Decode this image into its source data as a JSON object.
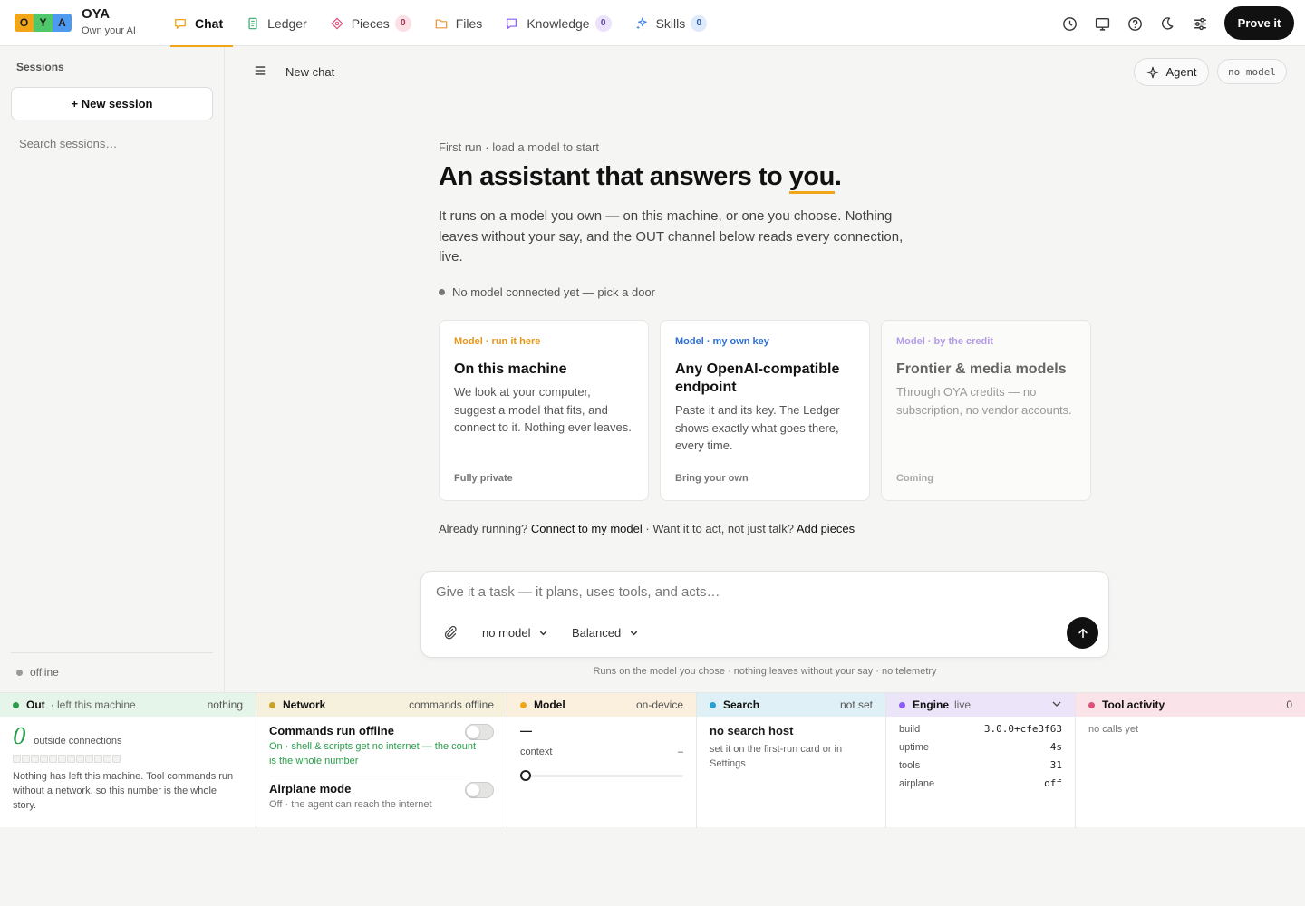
{
  "app": {
    "logo_letters": [
      "O",
      "Y",
      "A"
    ],
    "name": "OYA",
    "tagline": "Own your AI"
  },
  "nav": {
    "tabs": [
      {
        "label": "Chat",
        "icon": "chat-bubble-icon",
        "badge": null,
        "active": true
      },
      {
        "label": "Ledger",
        "icon": "receipt-icon",
        "badge": null
      },
      {
        "label": "Pieces",
        "icon": "puzzle-piece-icon",
        "badge": "0"
      },
      {
        "label": "Files",
        "icon": "folder-icon",
        "badge": null
      },
      {
        "label": "Knowledge",
        "icon": "knowledge-icon",
        "badge": "0"
      },
      {
        "label": "Skills",
        "icon": "sparkle-icon",
        "badge": "0"
      }
    ],
    "right_icons": [
      "history-icon",
      "monitor-icon",
      "help-icon",
      "moon-icon",
      "sliders-icon"
    ],
    "prove_label": "Prove it"
  },
  "sidebar": {
    "title": "Sessions",
    "new_session_label": "+ New session",
    "search_placeholder": "Search sessions…",
    "status_label": "offline"
  },
  "header": {
    "title": "New chat",
    "agent_label": "Agent",
    "model_pill": "no model"
  },
  "hero": {
    "kicker": "First run · load a model to start",
    "headline_pre": "An assistant that answers to ",
    "headline_highlight": "you",
    "headline_post": ".",
    "lede": "It runs on a model you own — on this machine, or one you choose. Nothing leaves without your say, and the OUT channel below reads every connection, live.",
    "status": "No model connected yet — pick a door"
  },
  "cards": [
    {
      "kicker": "Model · run it here",
      "title": "On this machine",
      "desc": "We look at your computer, suggest a model that fits, and connect to it. Nothing ever leaves.",
      "footer": "Fully private"
    },
    {
      "kicker": "Model · my own key",
      "title": "Any OpenAI-compatible endpoint",
      "desc": "Paste it and its key. The Ledger shows exactly what goes there, every time.",
      "footer": "Bring your own"
    },
    {
      "kicker": "Model · by the credit",
      "title": "Frontier & media models",
      "desc": "Through OYA credits — no subscription, no vendor accounts.",
      "footer": "Coming"
    }
  ],
  "already": {
    "q1": "Already running?",
    "link1": "Connect to my model",
    "q2": "· Want it to act, not just talk?",
    "link2": "Add pieces"
  },
  "composer": {
    "placeholder": "Give it a task — it plans, uses tools, and acts…",
    "model_select": "no model",
    "mode_select": "Balanced",
    "footnote": "Runs on the model you chose · nothing leaves without your say · no telemetry"
  },
  "panels": {
    "out": {
      "title": "Out",
      "subtitle": "· left this machine",
      "right": "nothing",
      "count": "0",
      "count_label": "outside connections",
      "desc": "Nothing has left this machine. Tool commands run without a network, so this number is the whole story."
    },
    "network": {
      "title": "Network",
      "right": "commands offline",
      "commands_title": "Commands run offline",
      "commands_sub": "On · shell & scripts get no internet — the count is the whole number",
      "airplane_title": "Airplane mode",
      "airplane_sub": "Off · the agent can reach the internet"
    },
    "model": {
      "title": "Model",
      "right": "on-device",
      "name": "—",
      "context_label": "context",
      "context_value": "–"
    },
    "search": {
      "title": "Search",
      "right": "not set",
      "host": "no search host",
      "desc": "set it on the first-run card or in Settings"
    },
    "engine": {
      "title": "Engine",
      "status": "live",
      "rows": [
        {
          "k": "build",
          "v": "3.0.0+cfe3f63"
        },
        {
          "k": "uptime",
          "v": "4s"
        },
        {
          "k": "tools",
          "v": "31"
        },
        {
          "k": "airplane",
          "v": "off"
        }
      ]
    },
    "tools": {
      "title": "Tool activity",
      "right": "0",
      "empty": "no calls yet"
    }
  },
  "colors": {
    "accent": "#f2a516",
    "out": "#2a9d4a",
    "network": "#c9a227",
    "model": "#f2a516",
    "search": "#2b9fd0",
    "engine": "#8b5cf6",
    "tools": "#e0507a"
  }
}
